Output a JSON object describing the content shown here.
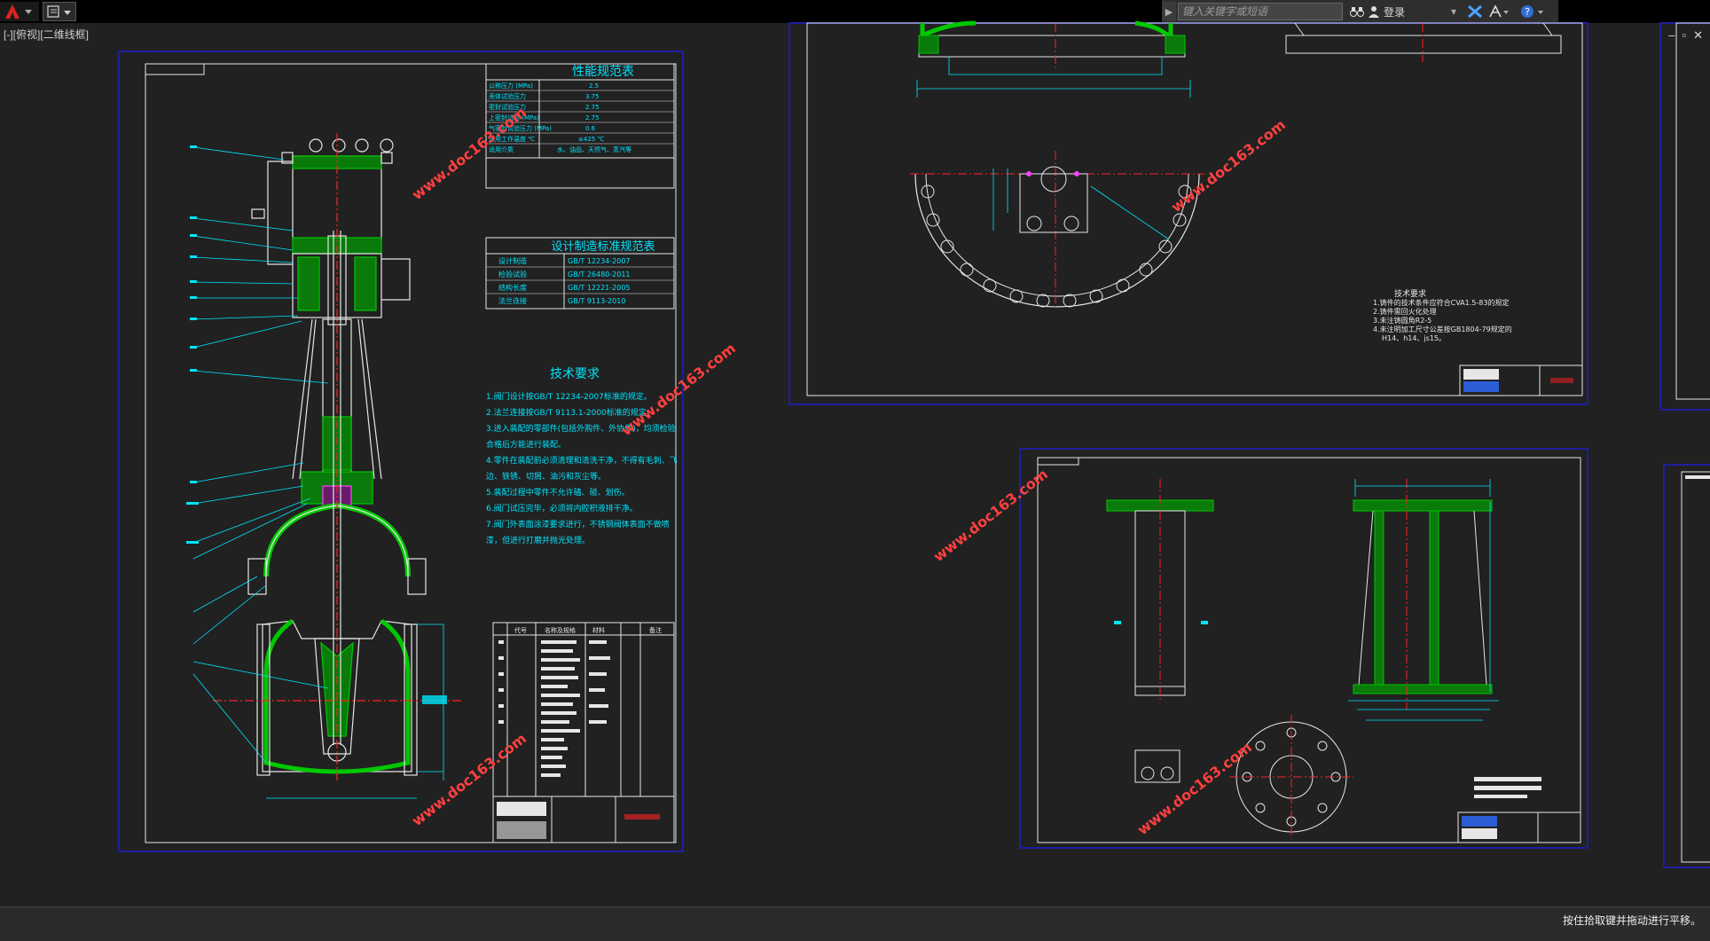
{
  "app": {
    "title_bar": {
      "logo_icon": "autocad-logo-icon",
      "quick_access_icon": "document-edit-icon"
    },
    "search": {
      "placeholder": "键入关键字或短语",
      "login_label": "登录"
    },
    "viewport_label": "[-][俯视][二维线框]",
    "status_message": "按住拾取键并拖动进行平移。",
    "window_controls": [
      "–",
      "▫",
      "✕"
    ]
  },
  "drawing": {
    "watermark": "www.doc163.com",
    "sheet1": {
      "perf_table_title": "性能规范表",
      "perf_rows": [
        [
          "公称压力 (MPa)",
          "2.5"
        ],
        [
          "壳体试验压力",
          "3.75"
        ],
        [
          "密封试验压力",
          "2.75"
        ],
        [
          "上密封试验 (MPa)",
          "2.75"
        ],
        [
          "气密封试验压力 (MPa)",
          "0.6"
        ],
        [
          "适用工作温度 ℃",
          "≤425 ℃"
        ],
        [
          "适用介质",
          "水、油品、天然气、蒸汽等"
        ]
      ],
      "std_table_title": "设计制造标准规范表",
      "std_rows": [
        [
          "设计制造",
          "GB/T 12234-2007"
        ],
        [
          "检验试验",
          "GB/T 26480-2011"
        ],
        [
          "结构长度",
          "GB/T 12221-2005"
        ],
        [
          "法兰连接",
          "GB/T 9113-2010"
        ]
      ],
      "tech_title": "技术要求",
      "tech_lines": [
        "1.阀门设计按GB/T 12234-2007标准的规定。",
        "2.法兰连接按GB/T 9113.1-2000标准的规定。",
        "3.进入装配的零部件(包括外购件、外协件)，均须检验",
        "合格后方能进行装配。",
        "4.零件在装配前必须清理和清洗干净，不得有毛刺、飞",
        "边、铁锈、切屑、油污和灰尘等。",
        "5.装配过程中零件不允许磕、碰、划伤。",
        "6.阀门试压完毕，必须将内腔积液排干净。",
        "7.阀门外表面涂漆要求进行，不锈钢阀体表面不做喷",
        "漆，但进行打磨并抛光处理。"
      ],
      "bom_headers": [
        "代号",
        "名称及规格",
        "材料",
        "备注"
      ]
    },
    "sheet2": {
      "tech_title": "技术要求",
      "tech_lines": [
        "1.铸件的技术条件应符合CVA1.5-83的规定",
        "2.铸件需回火化处理",
        "3.未注铸圆角R2-5",
        "4.未注明加工尺寸公差按GB1804-79规定的",
        "H14、h14、js15。"
      ]
    }
  },
  "colors": {
    "background": "#212121",
    "sheet_border": "#1e1ea0",
    "line_white": "#e6e6e6",
    "cyan": "#00e5ff",
    "green": "#00c800",
    "red": "#ff2020",
    "magenta": "#ff40ff"
  }
}
